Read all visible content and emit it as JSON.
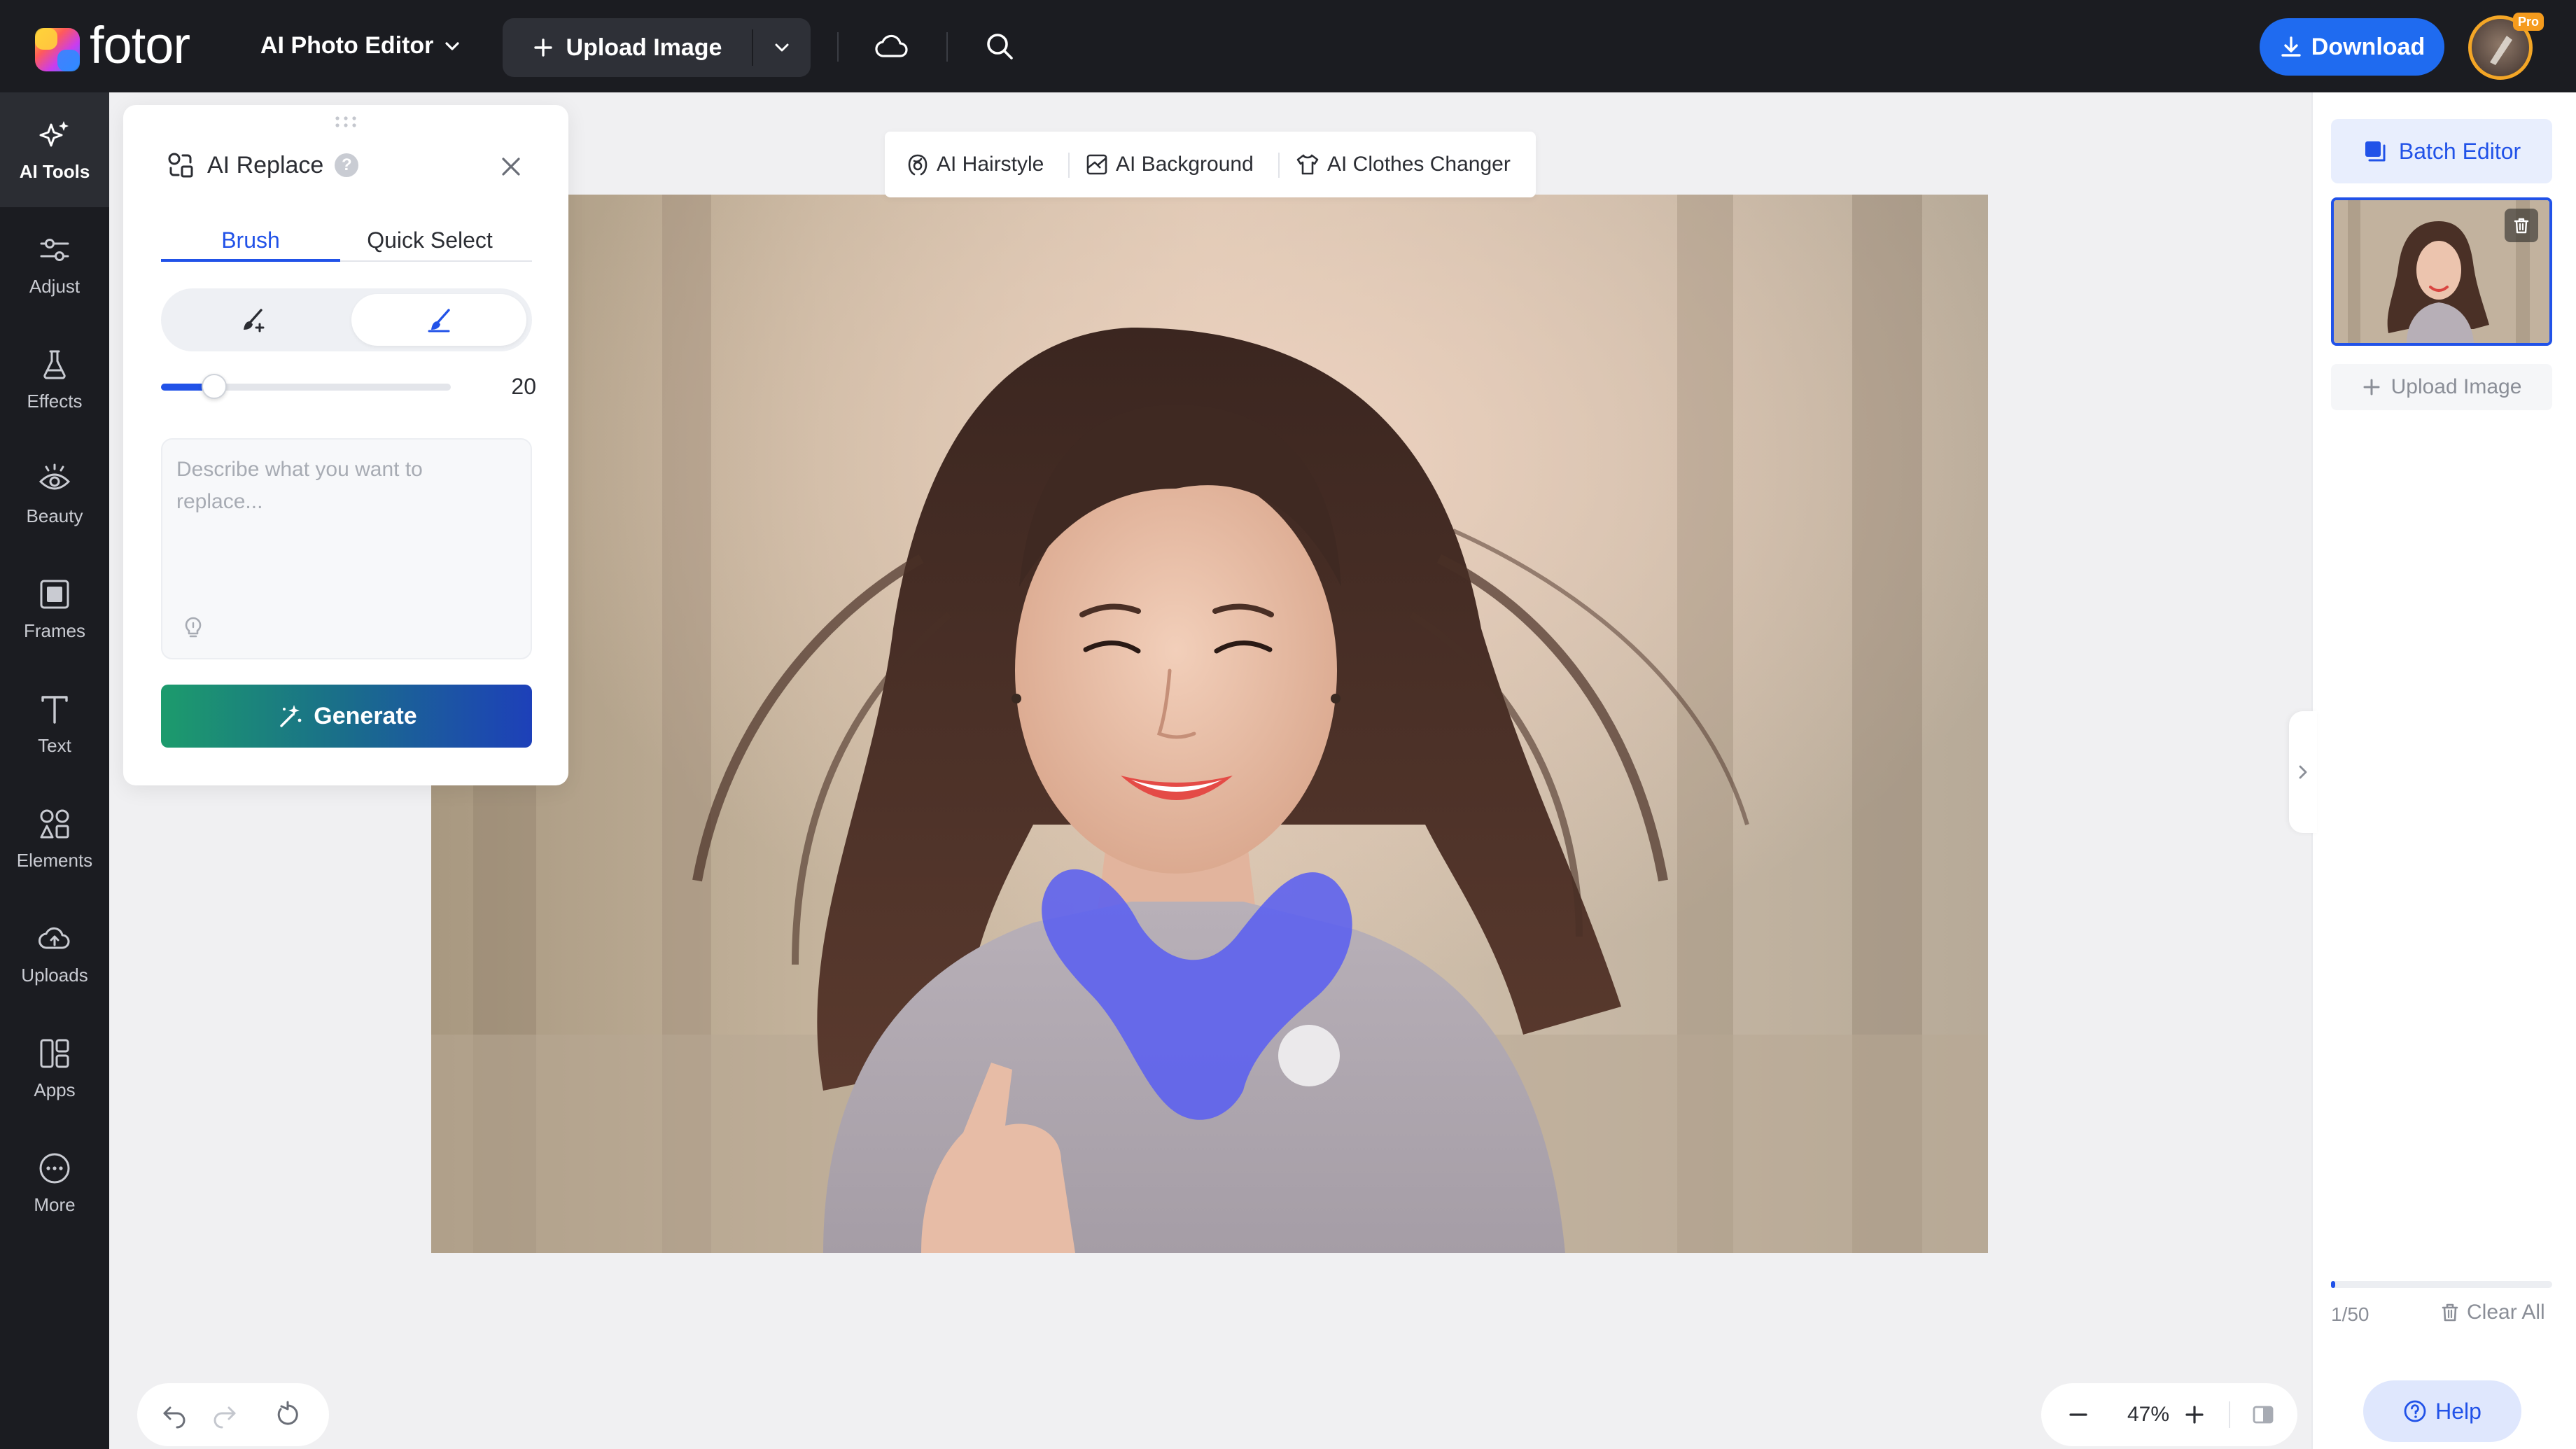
{
  "app": {
    "logo_text": "fotor",
    "menu_label": "AI Photo Editor",
    "upload_label": "Upload Image",
    "download_label": "Download",
    "pro_badge": "Pro"
  },
  "rail": {
    "items": [
      {
        "label": "AI Tools",
        "icon": "ai-tools-icon"
      },
      {
        "label": "Adjust",
        "icon": "adjust-icon"
      },
      {
        "label": "Effects",
        "icon": "effects-icon"
      },
      {
        "label": "Beauty",
        "icon": "beauty-icon"
      },
      {
        "label": "Frames",
        "icon": "frames-icon"
      },
      {
        "label": "Text",
        "icon": "text-icon"
      },
      {
        "label": "Elements",
        "icon": "elements-icon"
      },
      {
        "label": "Uploads",
        "icon": "uploads-icon"
      },
      {
        "label": "Apps",
        "icon": "apps-icon"
      },
      {
        "label": "More",
        "icon": "more-icon"
      }
    ]
  },
  "panel": {
    "title": "AI Replace",
    "help": "?",
    "tabs": [
      {
        "label": "Brush",
        "active": true
      },
      {
        "label": "Quick Select",
        "active": false
      }
    ],
    "brush_size": "20",
    "prompt_value": "",
    "prompt_placeholder": "Describe what you want to replace...",
    "generate_label": "Generate"
  },
  "quick_tools": [
    {
      "label": "AI Hairstyle",
      "icon": "hairstyle-icon"
    },
    {
      "label": "AI Background",
      "icon": "background-icon"
    },
    {
      "label": "AI Clothes Changer",
      "icon": "clothes-icon"
    }
  ],
  "right_panel": {
    "batch_label": "Batch Editor",
    "upload_label": "Upload Image",
    "count": "1/50",
    "clear_label": "Clear All",
    "help_label": "Help"
  },
  "zoom": {
    "value": "47%"
  },
  "colors": {
    "accent": "#2152e8",
    "topbar": "#1b1c21",
    "mask": "#5b60f0",
    "download": "#1f6bf0"
  }
}
